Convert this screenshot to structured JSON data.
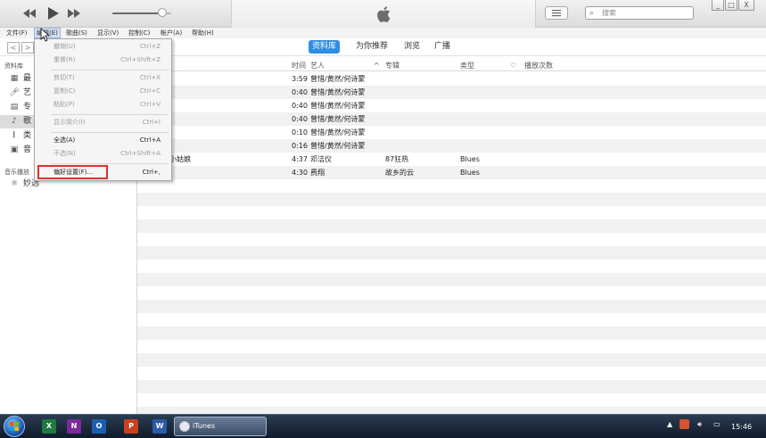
{
  "toolbar": {
    "prev_icon": "rewind-icon",
    "play_icon": "play-icon",
    "next_icon": "fast-forward-icon",
    "volume_level": 0.85,
    "search_placeholder": "搜索",
    "window_controls": [
      "_",
      "□",
      "X"
    ]
  },
  "menubar": {
    "items": [
      "文件(F)",
      "编辑(E)",
      "歌曲(S)",
      "显示(V)",
      "控制(C)",
      "帐户(A)",
      "帮助(H)"
    ]
  },
  "nav": {
    "back": "<",
    "forward": ">",
    "tabs": [
      "资料库",
      "为你推荐",
      "浏览",
      "广播"
    ],
    "active_tab": "资料库"
  },
  "sidebar": {
    "library_heading": "资料库",
    "items": [
      {
        "label": "最",
        "icon": "grid-icon"
      },
      {
        "label": "艺",
        "icon": "microphone-icon"
      },
      {
        "label": "专",
        "icon": "album-icon"
      },
      {
        "label": "歌",
        "icon": "music-note-icon"
      },
      {
        "label": "类",
        "icon": "genre-icon"
      },
      {
        "label": "音",
        "icon": "music-video-icon"
      }
    ],
    "playlists_heading": "音乐播放",
    "playlist_items": [
      {
        "label": "妙选",
        "icon": "genius-icon"
      }
    ]
  },
  "list": {
    "headers": [
      "时间",
      "艺人",
      "专辑",
      "类型",
      "♡",
      "播放次数"
    ],
    "rows": [
      {
        "title": "的",
        "time": "3:59",
        "artist": "曾惜/黄然/何诗蒙",
        "album": "",
        "genre": ""
      },
      {
        "title": "的",
        "time": "0:40",
        "artist": "曾惜/黄然/何诗蒙",
        "album": "",
        "genre": ""
      },
      {
        "title": "的",
        "time": "0:40",
        "artist": "曾惜/黄然/何诗蒙",
        "album": "",
        "genre": ""
      },
      {
        "title": "的",
        "time": "0:40",
        "artist": "曾惜/黄然/何诗蒙",
        "album": "",
        "genre": ""
      },
      {
        "title": "的",
        "time": "0:10",
        "artist": "曾惜/黄然/何诗蒙",
        "album": "",
        "genre": ""
      },
      {
        "title": "的",
        "time": "0:16",
        "artist": "曾惜/黄然/何诗蒙",
        "album": "",
        "genre": ""
      },
      {
        "title": "下的小姑娘",
        "time": "4:37",
        "artist": "邓洁仪",
        "album": "87狂热",
        "genre": "Blues"
      },
      {
        "title": "的云",
        "time": "4:30",
        "artist": "费翔",
        "album": "故乡的云",
        "genre": "Blues"
      }
    ]
  },
  "edit_menu": {
    "items": [
      {
        "label": "撤销(U)",
        "shortcut": "Ctrl+Z",
        "disabled": true
      },
      {
        "label": "重做(R)",
        "shortcut": "Ctrl+Shift+Z",
        "disabled": true
      },
      {
        "label": "剪切(T)",
        "shortcut": "Ctrl+X",
        "disabled": true
      },
      {
        "label": "复制(C)",
        "shortcut": "Ctrl+C",
        "disabled": true
      },
      {
        "label": "粘贴(P)",
        "shortcut": "Ctrl+V",
        "disabled": true
      },
      {
        "label": "显示简介(I)",
        "shortcut": "Ctrl+I",
        "disabled": true
      },
      {
        "label": "全选(A)",
        "shortcut": "Ctrl+A",
        "disabled": false
      },
      {
        "label": "不选(N)",
        "shortcut": "Ctrl+Shift+A",
        "disabled": true
      },
      {
        "label": "偏好设置(F)...",
        "shortcut": "Ctrl+,",
        "disabled": false
      }
    ],
    "highlighted_item": "偏好设置(F)..."
  },
  "taskbar": {
    "apps": [
      {
        "letter": "X",
        "color": "#1f7a3e",
        "icon": "excel-icon"
      },
      {
        "letter": "N",
        "color": "#7b2a9a",
        "icon": "onenote-icon"
      },
      {
        "letter": "O",
        "color": "#1b5fb4",
        "icon": "outlook-icon"
      },
      {
        "letter": "P",
        "color": "#c8421e",
        "icon": "powerpoint-icon"
      },
      {
        "letter": "W",
        "color": "#2b5aa8",
        "icon": "word-icon"
      }
    ],
    "active_task": "iTunes",
    "clock": "15:46"
  },
  "colors": {
    "accent": "#2f8ee2",
    "highlight_box": "#d9332e",
    "taskbar": "#1c2a3e"
  }
}
